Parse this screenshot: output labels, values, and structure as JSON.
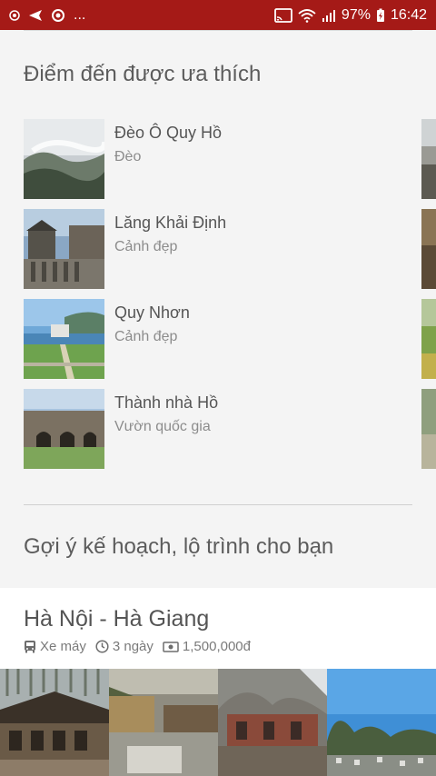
{
  "status_bar": {
    "left_icons": [
      "record-icon",
      "send-icon",
      "sync-icon"
    ],
    "more": "...",
    "battery": "97%",
    "time": "16:42",
    "background_color": "#a51a17"
  },
  "favorites": {
    "title": "Điểm đến được ưa thích",
    "items": [
      {
        "name": "Đèo Ô Quy Hồ",
        "type": "Đèo"
      },
      {
        "name": "Lăng Khải Định",
        "type": "Cảnh đẹp"
      },
      {
        "name": "Quy Nhơn",
        "type": "Cảnh đẹp"
      },
      {
        "name": "Thành nhà Hồ",
        "type": "Vườn quốc gia"
      }
    ]
  },
  "plans": {
    "title": "Gợi ý kế hoạch, lộ trình cho bạn",
    "card": {
      "title": "Hà Nội - Hà Giang",
      "transport": "Xe máy",
      "duration": "3 ngày",
      "cost": "1,500,000đ"
    }
  }
}
